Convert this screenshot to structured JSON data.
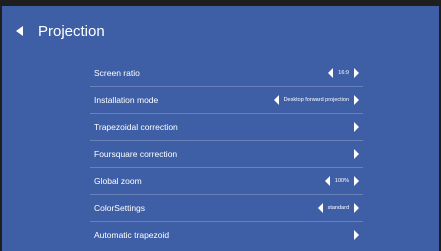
{
  "header": {
    "title": "Projection"
  },
  "settings": [
    {
      "label": "Screen ratio",
      "value": "16:9",
      "has_value": true
    },
    {
      "label": "Installation mode",
      "value": "Desktop forward projection",
      "has_value": true
    },
    {
      "label": "Trapezoidal correction",
      "has_value": false
    },
    {
      "label": "Foursquare correction",
      "has_value": false
    },
    {
      "label": "Global zoom",
      "value": "100%",
      "has_value": true
    },
    {
      "label": "ColorSettings",
      "value": "standard",
      "has_value": true
    },
    {
      "label": "Automatic trapezoid",
      "has_value": false
    }
  ],
  "icons": {
    "back": "back-arrow-icon",
    "prev": "left-arrow-icon",
    "next": "right-arrow-icon"
  },
  "colors": {
    "background": "#3e5fa6",
    "text": "#ffffff"
  }
}
